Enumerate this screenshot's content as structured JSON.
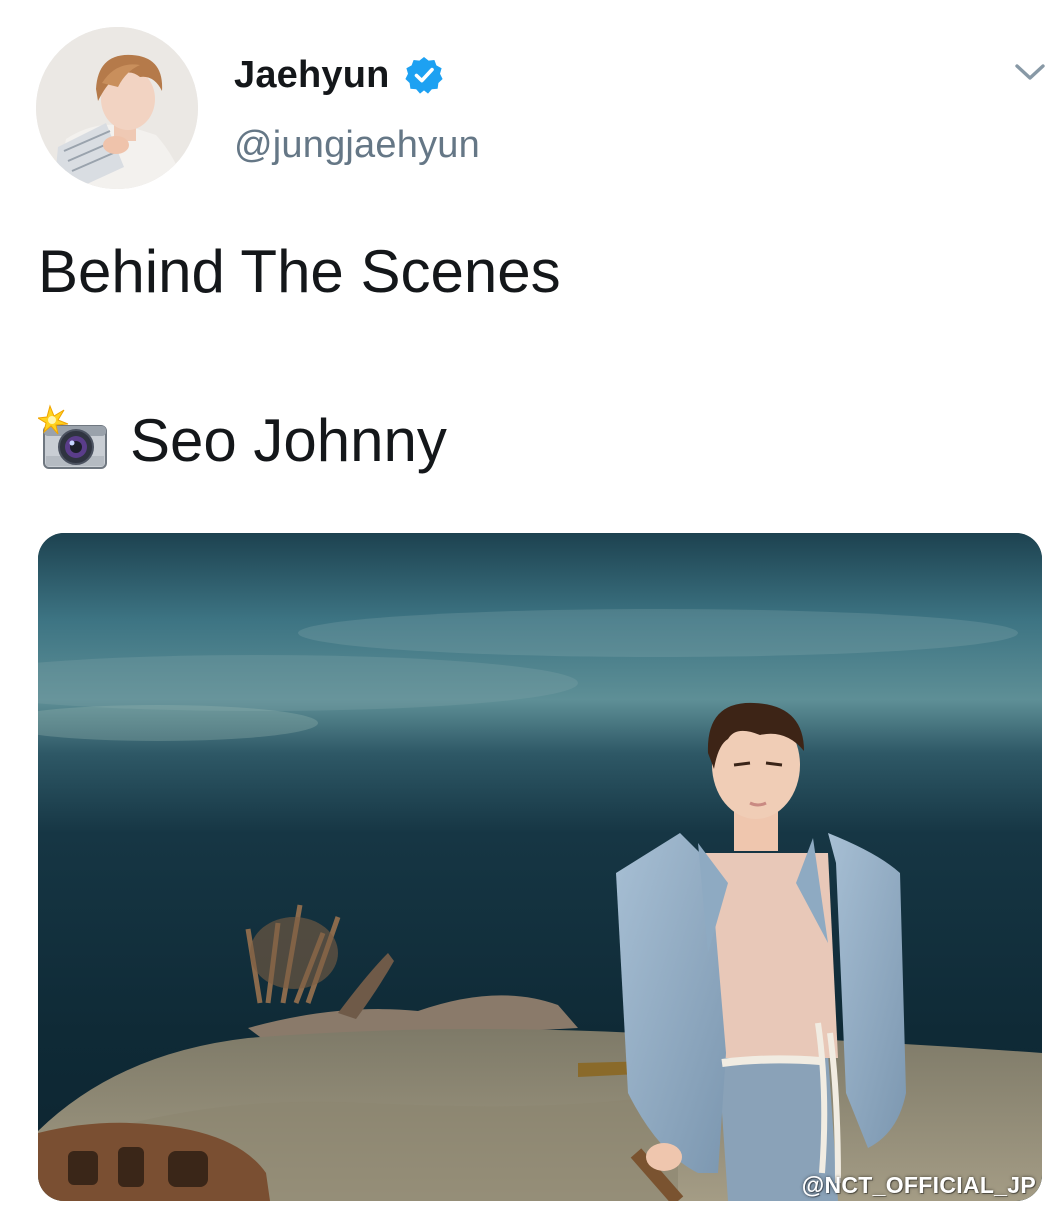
{
  "tweet": {
    "author": {
      "display_name": "Jaehyun",
      "handle": "@jungjaehyun",
      "verified": true,
      "verified_color": "#1da1f2"
    },
    "text_line1": "Behind The Scenes",
    "text_line2_icon": "camera-with-flash-emoji",
    "text_line2": "Seo Johnny",
    "media": {
      "watermark": "@NCT_OFFICIAL_JP"
    }
  },
  "icons": {
    "options": "chevron-down-icon",
    "verified": "verified-badge-icon",
    "camera": "camera-flash-icon"
  }
}
